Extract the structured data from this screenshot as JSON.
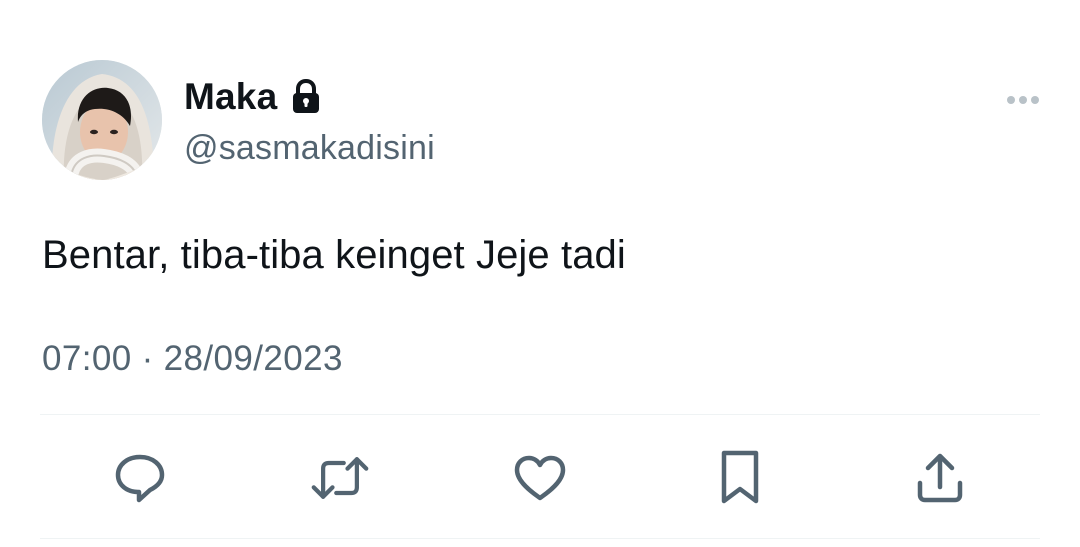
{
  "author": {
    "display_name": "Maka",
    "handle": "@sasmakadisini",
    "protected_icon": "lock-icon",
    "avatar": "profile-photo"
  },
  "tweet": {
    "text": "Bentar, tiba-tiba keinget Jeje tadi",
    "time": "07:00",
    "separator": "·",
    "date": "28/09/2023"
  },
  "actions": [
    {
      "name": "reply",
      "icon": "reply-icon"
    },
    {
      "name": "retweet",
      "icon": "retweet-icon"
    },
    {
      "name": "like",
      "icon": "heart-icon"
    },
    {
      "name": "bookmark",
      "icon": "bookmark-icon"
    },
    {
      "name": "share",
      "icon": "share-icon"
    }
  ],
  "colors": {
    "text_primary": "#0f1419",
    "text_secondary": "#536471",
    "divider": "#eff3f4",
    "background": "#ffffff"
  }
}
